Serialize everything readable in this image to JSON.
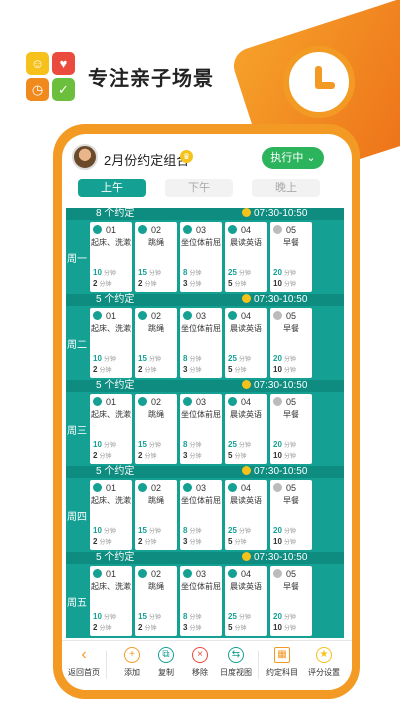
{
  "promo": {
    "headline": "专注亲子场景",
    "logo_glyphs": [
      "☺",
      "♥",
      "◷",
      "✓"
    ]
  },
  "app": {
    "group_title": "2月份约定组合",
    "crown_glyph": "♛",
    "exec_button": "执行中 ⌄",
    "segments": [
      "上午",
      "下午",
      "晚上"
    ],
    "active_segment": "上午",
    "units": {
      "mins": "分钟",
      "pts": "分钟"
    },
    "days": [
      {
        "name": "周一",
        "count": "8 个约定",
        "time": "07:30-10:50",
        "items": [
          {
            "num": "01",
            "name": "起床、洗漱",
            "mins": "10",
            "pts": "2",
            "grey": false
          },
          {
            "num": "02",
            "name": "跳绳",
            "mins": "15",
            "pts": "2",
            "grey": false
          },
          {
            "num": "03",
            "name": "坐位体前屈",
            "mins": "8",
            "pts": "3",
            "grey": false
          },
          {
            "num": "04",
            "name": "晨读英语",
            "mins": "25",
            "pts": "5",
            "grey": false
          },
          {
            "num": "05",
            "name": "早餐",
            "mins": "20",
            "pts": "10",
            "grey": true
          }
        ]
      },
      {
        "name": "周二",
        "count": "5 个约定",
        "time": "07:30-10:50",
        "items": [
          {
            "num": "01",
            "name": "起床、洗漱",
            "mins": "10",
            "pts": "2",
            "grey": false
          },
          {
            "num": "02",
            "name": "跳绳",
            "mins": "15",
            "pts": "2",
            "grey": false
          },
          {
            "num": "03",
            "name": "坐位体前屈",
            "mins": "8",
            "pts": "3",
            "grey": false
          },
          {
            "num": "04",
            "name": "晨读英语",
            "mins": "25",
            "pts": "5",
            "grey": false
          },
          {
            "num": "05",
            "name": "早餐",
            "mins": "20",
            "pts": "10",
            "grey": true
          }
        ]
      },
      {
        "name": "周三",
        "count": "5 个约定",
        "time": "07:30-10:50",
        "items": [
          {
            "num": "01",
            "name": "起床、洗漱",
            "mins": "10",
            "pts": "2",
            "grey": false
          },
          {
            "num": "02",
            "name": "跳绳",
            "mins": "15",
            "pts": "2",
            "grey": false
          },
          {
            "num": "03",
            "name": "坐位体前屈",
            "mins": "8",
            "pts": "3",
            "grey": false
          },
          {
            "num": "04",
            "name": "晨读英语",
            "mins": "25",
            "pts": "5",
            "grey": false
          },
          {
            "num": "05",
            "name": "早餐",
            "mins": "20",
            "pts": "10",
            "grey": true
          }
        ]
      },
      {
        "name": "周四",
        "count": "5 个约定",
        "time": "07:30-10:50",
        "items": [
          {
            "num": "01",
            "name": "起床、洗漱",
            "mins": "10",
            "pts": "2",
            "grey": false
          },
          {
            "num": "02",
            "name": "跳绳",
            "mins": "15",
            "pts": "2",
            "grey": false
          },
          {
            "num": "03",
            "name": "坐位体前屈",
            "mins": "8",
            "pts": "3",
            "grey": false
          },
          {
            "num": "04",
            "name": "晨读英语",
            "mins": "25",
            "pts": "5",
            "grey": false
          },
          {
            "num": "05",
            "name": "早餐",
            "mins": "20",
            "pts": "10",
            "grey": true
          }
        ]
      },
      {
        "name": "周五",
        "count": "5 个约定",
        "time": "07:30-10:50",
        "items": [
          {
            "num": "01",
            "name": "起床、洗漱",
            "mins": "10",
            "pts": "2",
            "grey": false
          },
          {
            "num": "02",
            "name": "跳绳",
            "mins": "15",
            "pts": "2",
            "grey": false
          },
          {
            "num": "03",
            "name": "坐位体前屈",
            "mins": "8",
            "pts": "3",
            "grey": false
          },
          {
            "num": "04",
            "name": "晨读英语",
            "mins": "25",
            "pts": "5",
            "grey": false
          },
          {
            "num": "05",
            "name": "早餐",
            "mins": "20",
            "pts": "10",
            "grey": true
          }
        ]
      }
    ],
    "toolbar": {
      "back": "返回首页",
      "add": "添加",
      "copy": "复制",
      "remove": "移除",
      "day_view": "日度视图",
      "subjects": "约定科目",
      "rating": "评分设置"
    },
    "toolbar_glyphs": {
      "back": "‹",
      "add": "+",
      "copy": "⧉",
      "remove": "×",
      "day_view": "⇆",
      "subjects": "▦",
      "rating": "★"
    }
  },
  "colors": {
    "accent_orange": "#f39a25",
    "teal": "#14a093",
    "green": "#2bb45c"
  }
}
